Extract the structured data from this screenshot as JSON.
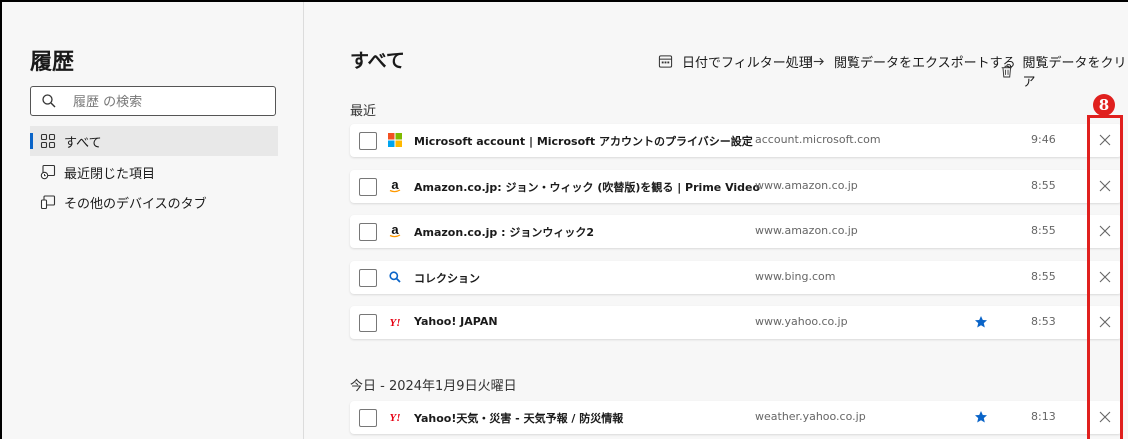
{
  "sidebar": {
    "title": "履歴",
    "search_placeholder": "履歴 の検索",
    "items": [
      {
        "label": "すべて",
        "active": true
      },
      {
        "label": "最近閉じた項目",
        "active": false
      },
      {
        "label": "その他のデバイスのタブ",
        "active": false
      }
    ]
  },
  "main": {
    "title": "すべて",
    "toolbar": {
      "filter": "日付でフィルター処理",
      "export": "閲覧データをエクスポートする",
      "clear": "閲覧データをクリア"
    },
    "sections": [
      {
        "label": "最近",
        "rows": [
          {
            "title": "Microsoft account | Microsoft アカウントのプライバシー設定",
            "domain": "account.microsoft.com",
            "time": "9:46",
            "favicon": "microsoft-icon",
            "starred": false
          },
          {
            "title": "Amazon.co.jp: ジョン・ウィック (吹替版)を観る | Prime Video",
            "domain": "www.amazon.co.jp",
            "time": "8:55",
            "favicon": "amazon-icon",
            "starred": false
          },
          {
            "title": "Amazon.co.jp : ジョンウィック2",
            "domain": "www.amazon.co.jp",
            "time": "8:55",
            "favicon": "amazon-icon",
            "starred": false
          },
          {
            "title": "コレクション",
            "domain": "www.bing.com",
            "time": "8:55",
            "favicon": "bing-search-icon",
            "starred": false
          },
          {
            "title": "Yahoo! JAPAN",
            "domain": "www.yahoo.co.jp",
            "time": "8:53",
            "favicon": "yahoo-icon",
            "starred": true
          }
        ]
      },
      {
        "label": "今日 - 2024年1月9日火曜日",
        "rows": [
          {
            "title": "Yahoo!天気・災害 - 天気予報 / 防災情報",
            "domain": "weather.yahoo.co.jp",
            "time": "8:13",
            "favicon": "yahoo-icon",
            "starred": true
          }
        ]
      }
    ]
  },
  "annotation": {
    "number": "8",
    "color": "#e0201e"
  },
  "colors": {
    "accent": "#0a64c8",
    "highlight": "#e0201e"
  }
}
